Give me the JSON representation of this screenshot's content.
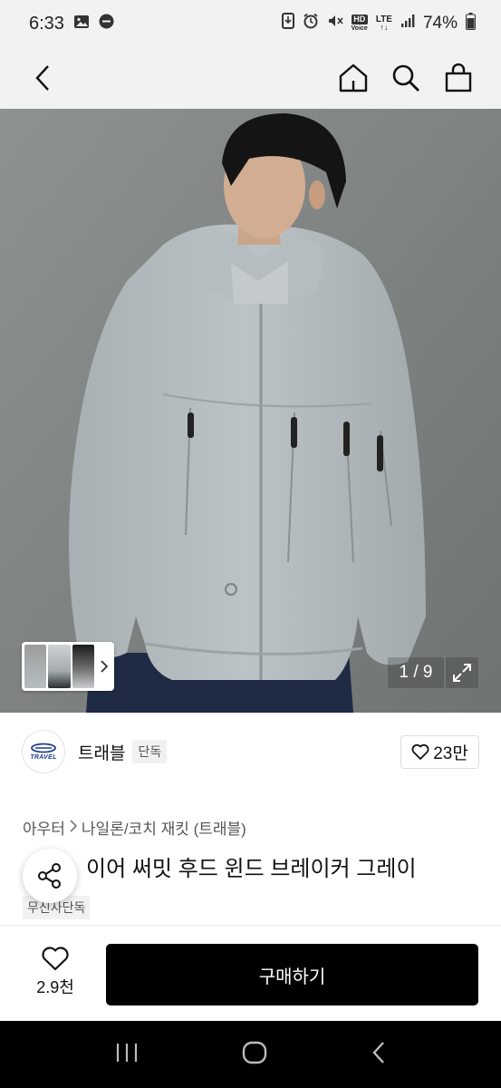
{
  "status_bar": {
    "time": "6:33",
    "battery": "74%",
    "hd_label": "HD",
    "voice_label": "Voice",
    "lte_label": "LTE",
    "left_icons": [
      "gallery-icon",
      "do-not-disturb-icon"
    ],
    "right_icons": [
      "download-icon",
      "alarm-icon",
      "mute-icon",
      "hd-voice-icon",
      "lte-icon",
      "signal-icon",
      "battery-icon"
    ]
  },
  "nav": {
    "icons": [
      "back-icon",
      "home-icon",
      "search-icon",
      "bag-icon"
    ]
  },
  "gallery": {
    "counter": "1 / 9",
    "expand_icon": "expand-icon",
    "thumb_more_icon": "chevron-right-icon"
  },
  "brand": {
    "logo_text": "TRAVEL",
    "name": "트래블",
    "badge": "단독",
    "likes": "23만"
  },
  "product": {
    "breadcrumb": [
      "아우터",
      "나일론/코치 재킷 (트래블)"
    ],
    "title": "이어 써밋 후드 윈드 브레이커 그레이",
    "exclusive": "무신사단독"
  },
  "bottom": {
    "wish_count": "2.9천",
    "buy_label": "구매하기"
  },
  "colors": {
    "status_bg": "#f2f2f2",
    "buy_button": "#000000",
    "jacket": "#b4bbbe"
  }
}
